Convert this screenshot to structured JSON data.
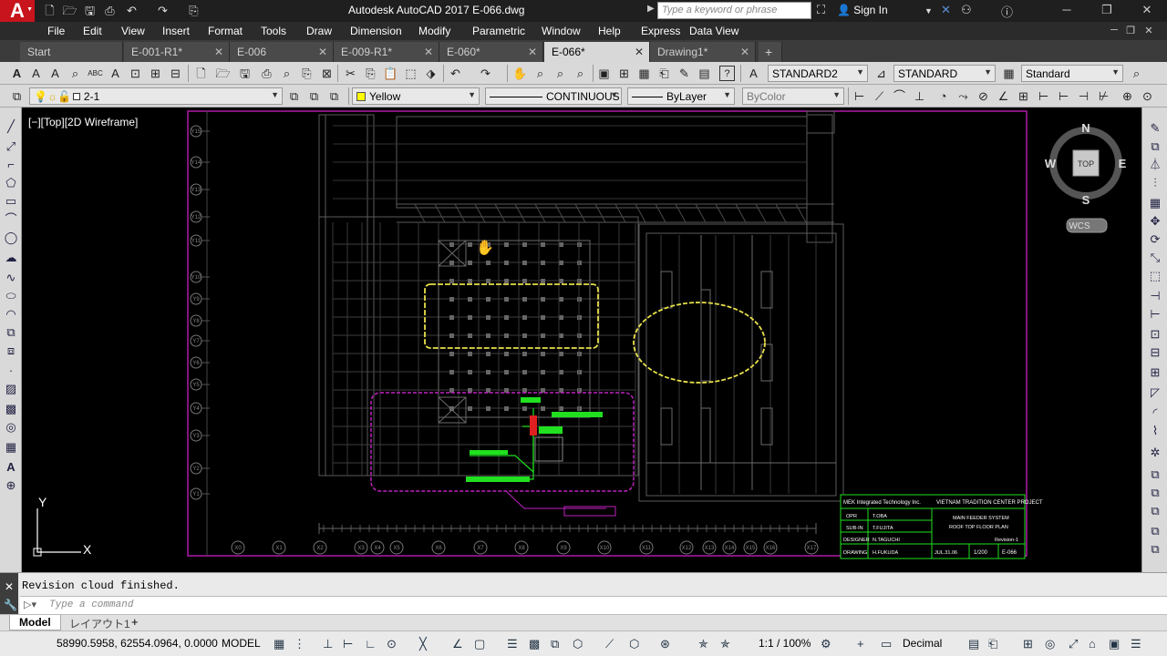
{
  "app": {
    "window_title": "Autodesk AutoCAD 2017    E-066.dwg",
    "search_placeholder": "Type a keyword or phrase",
    "sign_in": "Sign In"
  },
  "menu": [
    "File",
    "Edit",
    "View",
    "Insert",
    "Format",
    "Tools",
    "Draw",
    "Dimension",
    "Modify",
    "Parametric",
    "Window",
    "Help",
    "Express",
    "Data View"
  ],
  "tabs": [
    {
      "label": "Start",
      "active": false
    },
    {
      "label": "E-001-R1*",
      "active": false
    },
    {
      "label": "E-006",
      "active": false
    },
    {
      "label": "E-009-R1*",
      "active": false
    },
    {
      "label": "E-060*",
      "active": false
    },
    {
      "label": "E-066*",
      "active": true
    },
    {
      "label": "Drawing1*",
      "active": false
    }
  ],
  "styles": {
    "text_style": "STANDARD2",
    "dim_style": "STANDARD",
    "table_style": "Standard"
  },
  "layers": {
    "current_layer": "2-1",
    "color": "Yellow",
    "linetype": "CONTINUOUS",
    "lineweight": "ByLayer",
    "plotstyle": "ByColor"
  },
  "viewport": {
    "label": "[−][Top][2D Wireframe]",
    "viewcube": {
      "north": "N",
      "south": "S",
      "east": "E",
      "west": "W",
      "top": "TOP"
    },
    "ucs_label": "WCS",
    "ucs_x": "X",
    "ucs_y": "Y"
  },
  "title_block": {
    "company": "MEK Integrated Technology Inc.",
    "project": "VIETNAM TRADITION CENTER PROJECT",
    "roles": [
      {
        "role": "OPR",
        "name": "T.OBA"
      },
      {
        "role": "SUB-IN",
        "name": "T.FUJITA"
      },
      {
        "role": "DESIGNER",
        "name": "N.TAGUCHI"
      },
      {
        "role": "DRAWING",
        "name": "H.FUKUDA"
      }
    ],
    "description_1": "MAIN FEEDER SYSTEM",
    "description_2": "ROOF TOP FLOOR PLAN",
    "revision": "Revision-1",
    "date": "JUL.31.06",
    "scale": "1/200",
    "sheet": "E-066"
  },
  "grid_bubbles_bottom": [
    "X0",
    "X1",
    "X2",
    "X3",
    "X4",
    "X5",
    "X6",
    "X7",
    "X8",
    "X9",
    "X10",
    "X11",
    "X12",
    "X13",
    "X14",
    "X15",
    "X16",
    "X17"
  ],
  "grid_bubbles_left": [
    "Y15",
    "Y14",
    "Y13",
    "Y12",
    "Y11",
    "Y10",
    "Y9",
    "Y8",
    "Y7",
    "Y6",
    "Y5",
    "Y4",
    "Y3",
    "Y2",
    "Y1"
  ],
  "command": {
    "history": "Revision cloud finished.",
    "placeholder": "Type a command"
  },
  "layout_tabs": [
    "Model",
    "レイアウト1"
  ],
  "status": {
    "coords": "58990.5958, 62554.0964, 0.0000",
    "space": "MODEL",
    "annotation_scale": "1:1 / 100%",
    "units": "Decimal"
  },
  "colors": {
    "accent_red": "#c8141c",
    "cloud_yellow": "#e8e04a",
    "cloud_magenta": "#c020c0",
    "feeder_green": "#20e020",
    "drawing_grey": "#5a5a5a"
  }
}
